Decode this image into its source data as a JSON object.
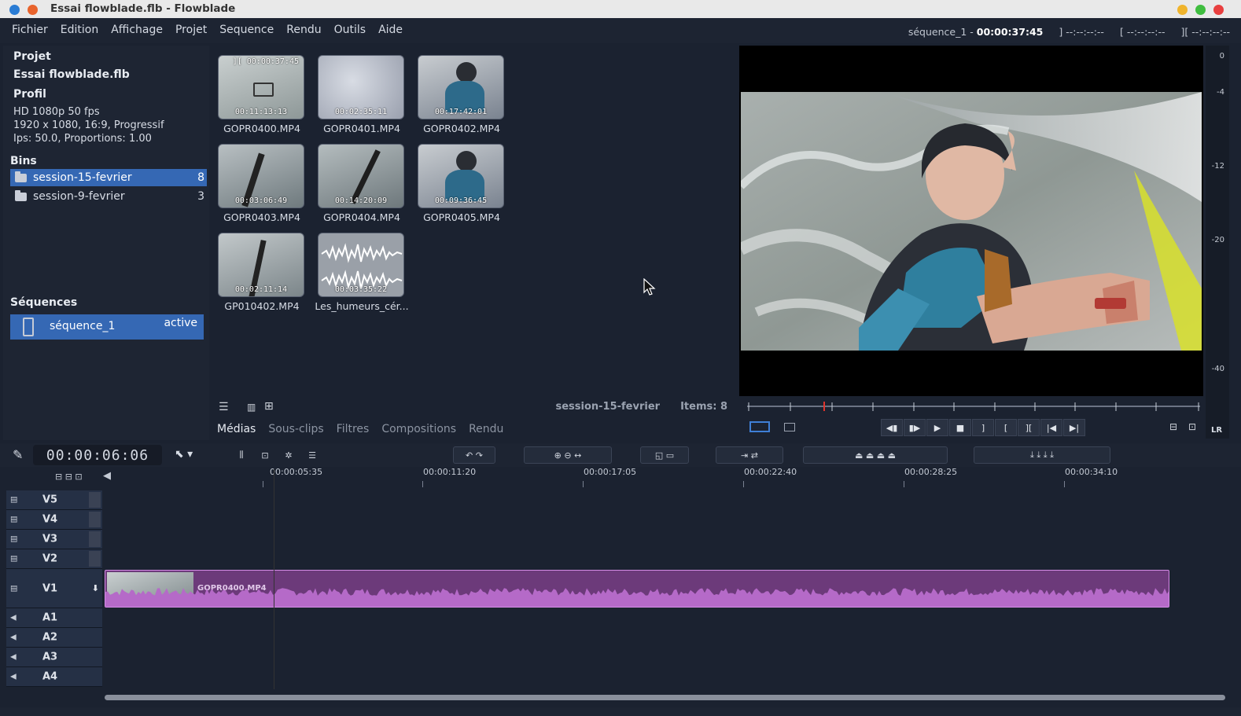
{
  "window": {
    "title": "Essai flowblade.flb - Flowblade"
  },
  "menu": [
    "Fichier",
    "Edition",
    "Affichage",
    "Projet",
    "Sequence",
    "Rendu",
    "Outils",
    "Aide"
  ],
  "timecode_bar": {
    "sequence": "séquence_1 -",
    "position": "00:00:37:45",
    "mark_out_prefix": "]",
    "mark_out": "--:--:--:--",
    "mark_in_prefix": "[",
    "mark_in": "--:--:--:--",
    "length_prefix": "][",
    "length": "--:--:--:--"
  },
  "project": {
    "heading": "Projet",
    "name": "Essai flowblade.flb",
    "profile_heading": "Profil",
    "profile_lines": [
      "HD 1080p 50 fps",
      "1920 x 1080, 16:9, Progressif",
      "Ips: 50.0, Proportions: 1.00"
    ],
    "bins_heading": "Bins",
    "bins": [
      {
        "name": "session-15-fevrier",
        "count": "8",
        "selected": true
      },
      {
        "name": "session-9-fevrier",
        "count": "3",
        "selected": false
      }
    ],
    "sequences_heading": "Séquences",
    "sequence": {
      "name": "séquence_1",
      "status": "active"
    }
  },
  "media": {
    "items": [
      {
        "file": "GOPR0400.MP4",
        "duration": "00:11:13:13",
        "top": "][ 00:00:37:45"
      },
      {
        "file": "GOPR0401.MP4",
        "duration": "00:02:35:11",
        "top": ""
      },
      {
        "file": "GOPR0402.MP4",
        "duration": "00:17:42:01",
        "top": ""
      },
      {
        "file": "GOPR0403.MP4",
        "duration": "00:03:06:49",
        "top": ""
      },
      {
        "file": "GOPR0404.MP4",
        "duration": "00:14:20:09",
        "top": ""
      },
      {
        "file": "GOPR0405.MP4",
        "duration": "00:09:36:45",
        "top": ""
      },
      {
        "file": "GP010402.MP4",
        "duration": "00:02:11:14",
        "top": ""
      },
      {
        "file": "Les_humeurs_cér...",
        "duration": "00:03:35:22",
        "top": ""
      }
    ],
    "current_bin": "session-15-fevrier",
    "items_label": "Items: 8",
    "tabs": [
      "Médias",
      "Sous-clips",
      "Filtres",
      "Compositions",
      "Rendu"
    ],
    "active_tab": "Médias"
  },
  "monitor": {
    "vu_labels": [
      "0",
      "-4",
      "-12",
      "-20",
      "-40"
    ],
    "lr_label": "LR"
  },
  "timeline": {
    "timecode": "00:00:06:06",
    "ruler_labels": [
      "00:00:05:35",
      "00:00:11:20",
      "00:00:17:05",
      "00:00:22:40",
      "00:00:28:25",
      "00:00:34:10"
    ],
    "tracks": [
      "V5",
      "V4",
      "V3",
      "V2",
      "V1",
      "A1",
      "A2",
      "A3",
      "A4"
    ],
    "clip": {
      "name": "GOPR0400.MP4",
      "track": "V1",
      "color": "#6c3a7a"
    }
  },
  "colors": {
    "accent": "#3568b4",
    "clip": "#6c3a7a",
    "waveform": "#b56ac8"
  }
}
